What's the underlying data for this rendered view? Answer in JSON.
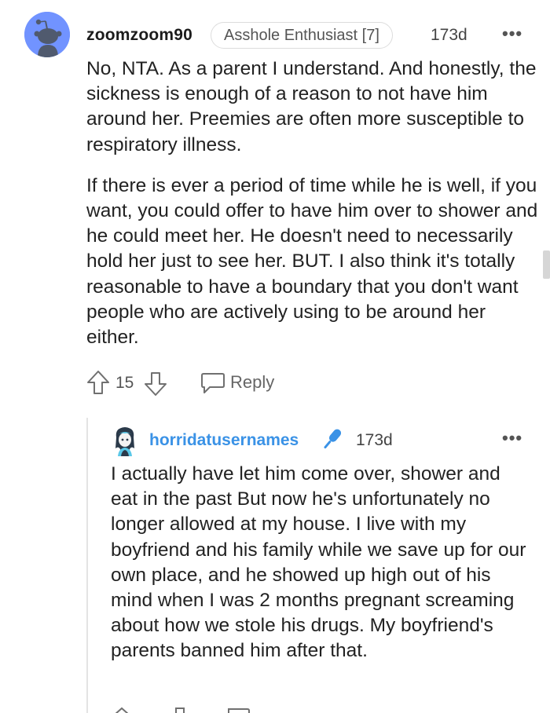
{
  "comments": [
    {
      "username": "zoomzoom90",
      "flair": "Asshole Enthusiast [7]",
      "age": "173d",
      "menu_label": "•••",
      "paragraphs": [
        "No, NTA. As a parent I understand. And honestly, the sickness is enough of a reason to not have him around her. Preemies are often more susceptible to respiratory illness.",
        "If there is ever a period of time while he is well, if you want, you could offer to have him over to shower and he could meet her. He doesn't need to necessarily hold her just to see her. BUT. I also think it's totally reasonable to have a boundary that you don't want people who are actively using to be around her either."
      ],
      "vote_count": "15",
      "reply_label": "Reply",
      "avatar_color": "#7193ff"
    },
    {
      "username": "horridatusernames",
      "age": "173d",
      "menu_label": "•••",
      "paragraphs": [
        "I actually have let him come over, shower and eat in the past But now he's unfortunately no longer allowed at my house. I live with my boyfriend and his family while we save up for our own place, and he showed up high out of his mind when I was 2 months pregnant screaming about how we stole his drugs. My boyfriend's parents banned him after that."
      ],
      "username_color": "#3a92e6",
      "badge_color": "#3a92e6"
    }
  ]
}
